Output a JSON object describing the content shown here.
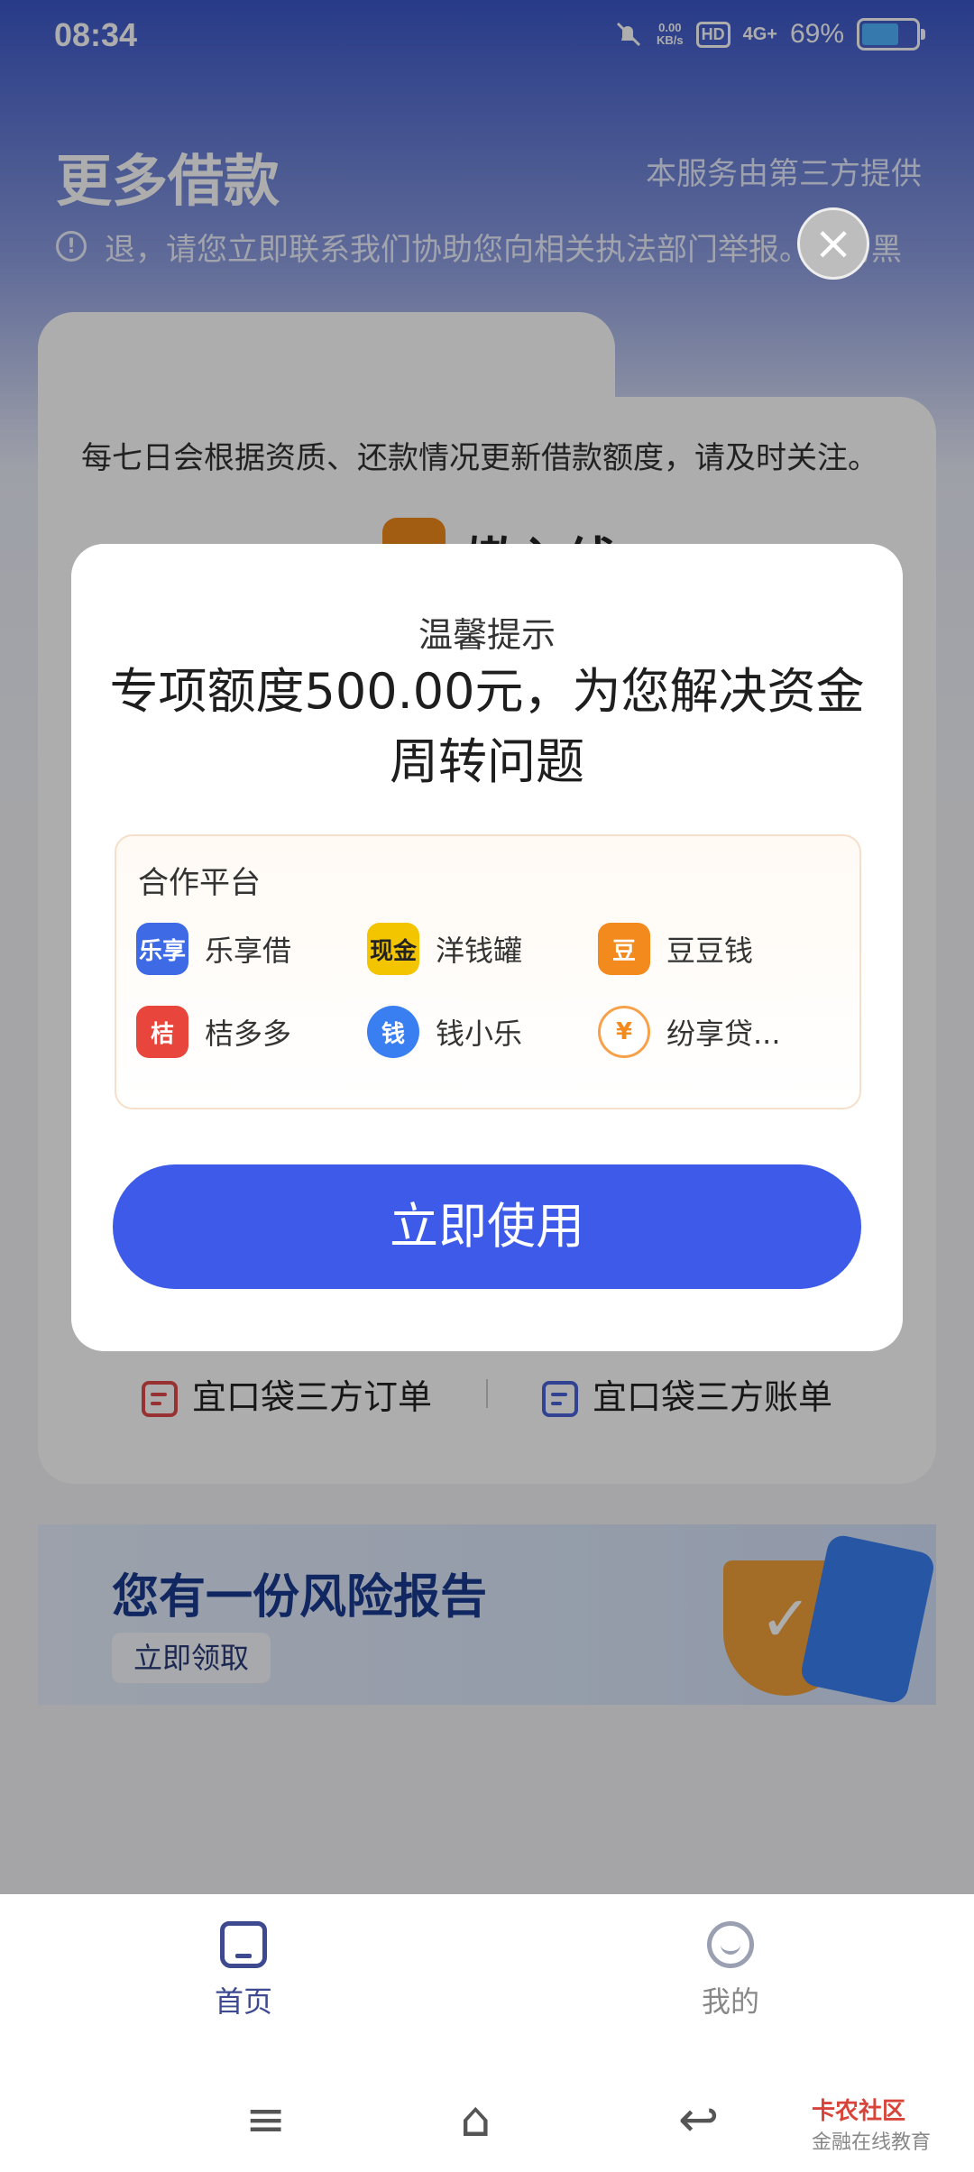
{
  "status_bar": {
    "time": "08:34",
    "net_speed": "0.00",
    "net_unit": "KB/s",
    "hd": "HD",
    "signal": "4G+",
    "battery": "69%",
    "battery_level": 0.69
  },
  "header": {
    "title": "更多借款",
    "provider_note": "本服务由第三方提供",
    "notice": "退，请您立即联系我们协助您向相关执法部门举报。如易黑"
  },
  "card": {
    "description": "每七日会根据资质、还款情况更新借款额度，请及时关注。",
    "brand_partial": "嫩入线",
    "links": [
      {
        "label": "宜口袋三方订单",
        "color": "#e04a4a"
      },
      {
        "label": "宜口袋三方账单",
        "color": "#4a63d9"
      }
    ]
  },
  "banner": {
    "title": "您有一份风险报告",
    "button": "立即领取"
  },
  "modal": {
    "subtitle": "温馨提示",
    "title": "专项额度500.00元，为您解决资金周转问题",
    "partners_label": "合作平台",
    "partners": [
      {
        "name": "乐享借",
        "logo_text": "乐享",
        "color": "#3f6ae6"
      },
      {
        "name": "洋钱罐",
        "logo_text": "现金",
        "color": "#f2c500"
      },
      {
        "name": "豆豆钱",
        "logo_text": "豆",
        "color": "#f28a1e"
      },
      {
        "name": "桔多多",
        "logo_text": "桔",
        "color": "#e8453c"
      },
      {
        "name": "钱小乐",
        "logo_text": "钱",
        "color": "#3a7ff2"
      },
      {
        "name": "纷享贷...",
        "logo_text": "¥",
        "color": "#f7a24a"
      }
    ],
    "cta": "立即使用",
    "close_icon": "×"
  },
  "bottom_nav": {
    "items": [
      {
        "label": "首页",
        "icon": "home-icon"
      },
      {
        "label": "我的",
        "icon": "profile-icon"
      }
    ]
  },
  "system_nav": {
    "menu": "≡",
    "home": "⌂",
    "back": "↩"
  },
  "watermark": {
    "brand": "卡农社区",
    "tagline": "金融在线教育"
  }
}
